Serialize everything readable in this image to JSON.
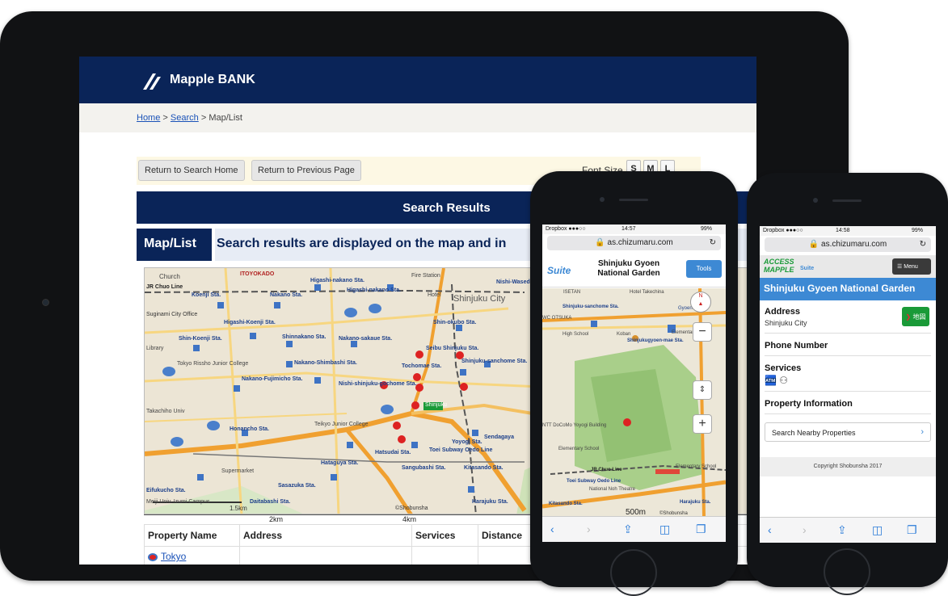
{
  "tablet": {
    "logo": "Mapple BANK",
    "breadcrumb": {
      "home": "Home",
      "sep1": ">",
      "search": "Search",
      "sep2": ">",
      "current": "Map/List"
    },
    "toolbar": {
      "return_home": "Return to Search Home",
      "return_prev": "Return to Previous Page",
      "font_size_label": "Font Size",
      "font_s": "S",
      "font_m": "M",
      "font_l": "L"
    },
    "results_title": "Search Results",
    "maplist_tag": "Map/List",
    "maplist_text": "Search results are displayed on the map and in",
    "map_labels": {
      "church": "Church",
      "itoyokado": "ITOYOKADO",
      "higashi_nakano": "Higashi-nakano Sta.",
      "fire_station": "Fire Station",
      "nishi_waseda": "Nishi-Waseda Sta",
      "jr_chuo": "JR Chuo Line",
      "koenji": "Koenji Sta.",
      "nakano": "Nakano Sta.",
      "higashi_nakano2": "Higashi-nakano Sta.",
      "hotel": "Hotel",
      "shinjuku_city": "Shinjuku City",
      "suginami": "Suginami City Office",
      "higashi_koenji": "Higashi-Koenji Sta.",
      "shin_okubo": "Shin-okubo Sta.",
      "shin_koenji": "Shin-Koenji Sta.",
      "shinnakano": "Shinnakano Sta.",
      "nakano_sakaue": "Nakano-sakaue Sta.",
      "seibu_shinjuku": "Seibu Shinjuku Sta.",
      "library": "Library",
      "tokyo_rissho": "Tokyo Rissho Junior College",
      "nakano_shimbashi": "Nakano-Shimbashi Sta.",
      "tochomae": "Tochomae Sta.",
      "shinjuku_sanchome": "Shinjuku-sanchome Sta.",
      "nakano_fujimicho": "Nakano-Fujimicho Sta.",
      "nishi_shinjuku_gochome": "Nishi-shinjuku-gochome Sta.",
      "shinjuku": "Shinjuku",
      "takachiho": "Takachiho Univ",
      "honancho": "Honancho Sta.",
      "teikyo": "Teikyo Junior College",
      "yoyogi": "Yoyogi Sta.",
      "sendagaya": "Sendagaya",
      "hatsudai": "Hatsudai Sta.",
      "toei_subway": "Toei Subway Oedo Line",
      "hataguya": "Hataguya Sta.",
      "sangubashi": "Sangubashi Sta.",
      "kitasando": "Kitasando Sta.",
      "supermarket": "Supermarket",
      "eifukucho": "Eifukucho Sta.",
      "sasazuka": "Sasazuka Sta.",
      "meiji_univ": "Meiji Univ. Izumi Campus",
      "daitabashi": "Daitabashi Sta.",
      "harajuku": "Harajuku Sta.",
      "scale_map": "1.5km",
      "shobunsha": "©Shobunsha"
    },
    "scale": {
      "a": "2km",
      "b": "4km"
    },
    "table": {
      "headers": [
        "Property Name",
        "Address",
        "Services",
        "Distance"
      ],
      "rows": [
        {
          "name": "Tokyo"
        }
      ]
    }
  },
  "phone1": {
    "status_left": "Dropbox ●●●○○",
    "time": "14:57",
    "battery": "99%",
    "url": "as.chizumaru.com",
    "logo": "Suite",
    "title": "Shinjuku Gyoen National Garden",
    "tools": "Tools",
    "map_labels": {
      "isetan": "ISETAN",
      "hotel_takeichina": "Hotel Takechina",
      "shinjuku_sanchome": "Shinjuku-sanchome Sta.",
      "gyoen": "Gyoen-mae",
      "wc_otsuka": "WC OTSUKA",
      "high_school": "High School",
      "koban": "Koban",
      "elementary": "Elementary School",
      "shinjukugyoen": "Shinjukugyoen-mae Sta.",
      "ntt": "NTT DoCoMo Yoyogi Building",
      "elementary2": "Elementary School",
      "elementary3": "Elementary School",
      "jr_chuo": "JR Chuo Line",
      "toei_oedo": "Toei Subway Oedo Line",
      "national_noh": "National Noh Theatre",
      "kitasando": "Kitasando Sta.",
      "harajuku_sta": "Harajuku Sta.",
      "scale": "500m",
      "shobunsha": "©Shobunsha"
    }
  },
  "phone2": {
    "status_left": "Dropbox ●●●○○",
    "time": "14:58",
    "battery": "99%",
    "url": "as.chizumaru.com",
    "logo_top": "ACCESS",
    "logo_bottom": "MAPPLE",
    "logo_suite": "Suite",
    "menu": "Menu",
    "title": "Shinjuku Gyoen National Garden",
    "address_label": "Address",
    "address_value": "Shinjuku City",
    "map_btn": "地図",
    "phone_label": "Phone Number",
    "services_label": "Services",
    "property_label": "Property Information",
    "nearby": "Search Nearby Properties",
    "copyright": "Copyright Shobunsha 2017"
  },
  "colors": {
    "navy": "#0a2458",
    "link": "#1a52b8",
    "accent_blue": "#3d89d4",
    "green": "#1a9a38"
  }
}
